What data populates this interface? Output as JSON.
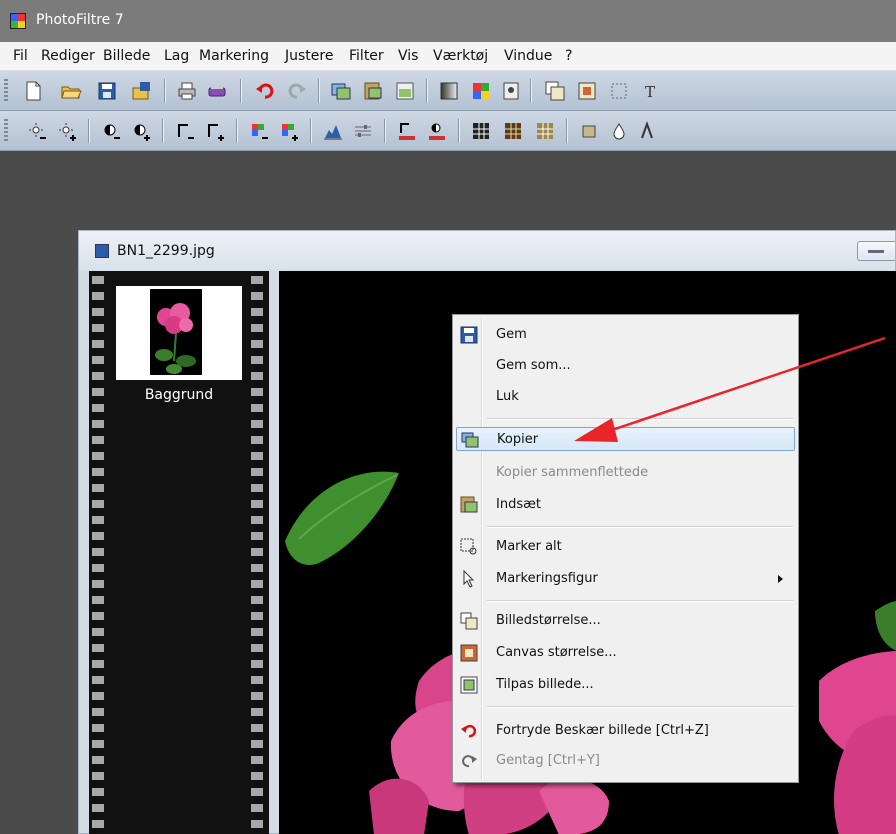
{
  "app": {
    "title": "PhotoFiltre 7"
  },
  "menu": [
    "Fil",
    "Rediger",
    "Billede",
    "Lag",
    "Markering",
    "Justere",
    "Filter",
    "Vis",
    "Værktøj",
    "Vindue",
    "?"
  ],
  "document": {
    "title": "BN1_2299.jpg",
    "layer_name": "Baggrund"
  },
  "context_menu": {
    "items": [
      {
        "label": "Gem",
        "icon": "floppy-disk-icon"
      },
      {
        "label": "Gem som..."
      },
      {
        "label": "Luk"
      },
      {
        "label": "Kopier",
        "icon": "copy-image-icon",
        "highlighted": true
      },
      {
        "label": "Kopier sammenflettede",
        "disabled": true
      },
      {
        "label": "Indsæt",
        "icon": "paste-image-icon"
      },
      {
        "label": "Marker alt",
        "icon": "select-all-icon"
      },
      {
        "label": "Markeringsfigur",
        "icon": "cursor-arrow-icon",
        "submenu": true
      },
      {
        "label": "Billedstørrelse...",
        "icon": "image-size-icon"
      },
      {
        "label": "Canvas størrelse...",
        "icon": "canvas-size-icon"
      },
      {
        "label": "Tilpas billede...",
        "icon": "fit-image-icon"
      },
      {
        "label": "Fortryde Beskær billede [Ctrl+Z]",
        "icon": "undo-icon"
      },
      {
        "label": "Gentag [Ctrl+Y]",
        "icon": "redo-icon",
        "disabled": true
      }
    ]
  },
  "colors": {
    "highlight": "#d6e7f8",
    "annotation_arrow": "#e8262a",
    "flower_pink": "#e0458f"
  }
}
